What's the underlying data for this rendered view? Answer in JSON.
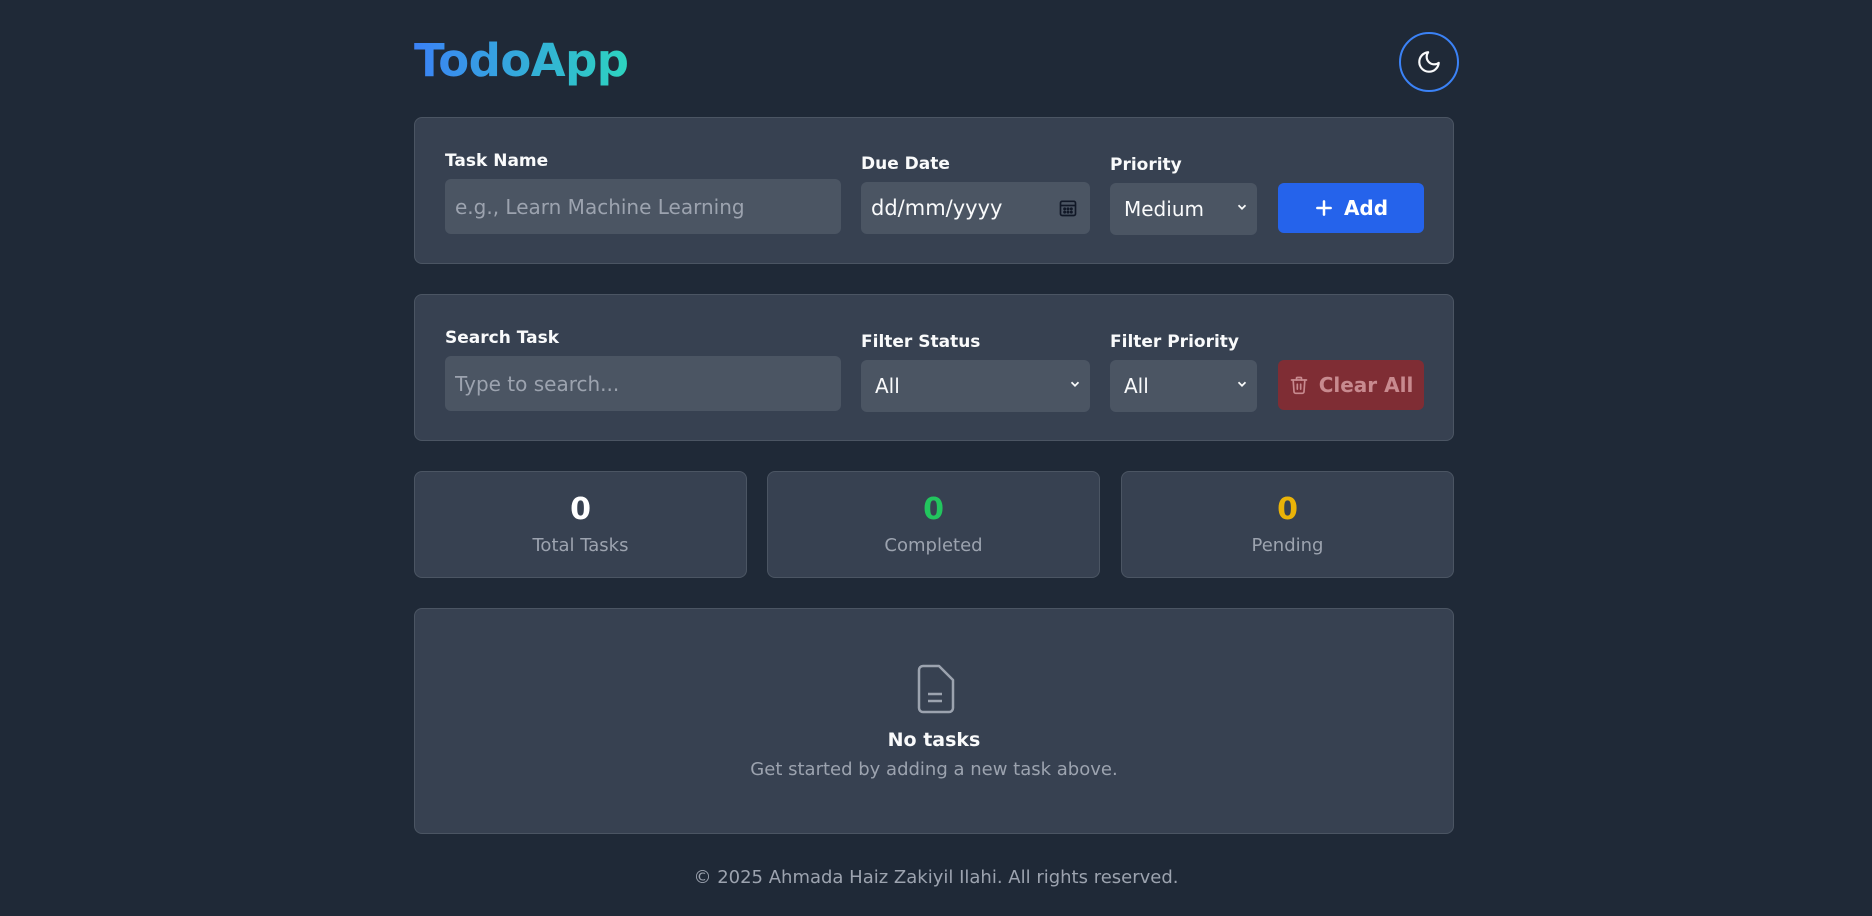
{
  "header": {
    "logo": "TodoApp",
    "theme_icon": "moon-icon"
  },
  "add_form": {
    "task_name_label": "Task Name",
    "task_name_placeholder": "e.g., Learn Machine Learning",
    "due_date_label": "Due Date",
    "due_date_placeholder": "dd/mm/yyyy",
    "priority_label": "Priority",
    "priority_value": "Medium",
    "add_label": "Add"
  },
  "filter_form": {
    "search_label": "Search Task",
    "search_placeholder": "Type to search...",
    "status_label": "Filter Status",
    "status_value": "All",
    "priority_label": "Filter Priority",
    "priority_value": "All",
    "clear_label": "Clear All"
  },
  "stats": [
    {
      "value": "0",
      "label": "Total Tasks",
      "color": "#ffffff"
    },
    {
      "value": "0",
      "label": "Completed",
      "color": "#22c55e"
    },
    {
      "value": "0",
      "label": "Pending",
      "color": "#eab308"
    }
  ],
  "empty_state": {
    "icon": "document-icon",
    "title": "No tasks",
    "subtitle": "Get started by adding a new task above."
  },
  "footer": {
    "text": "© 2025 Ahmada Haiz Zakiyil Ilahi. All rights reserved."
  },
  "colors": {
    "background": "#1f2937",
    "card": "#374151",
    "accent": "#2563eb",
    "danger": "#7f2d34"
  }
}
